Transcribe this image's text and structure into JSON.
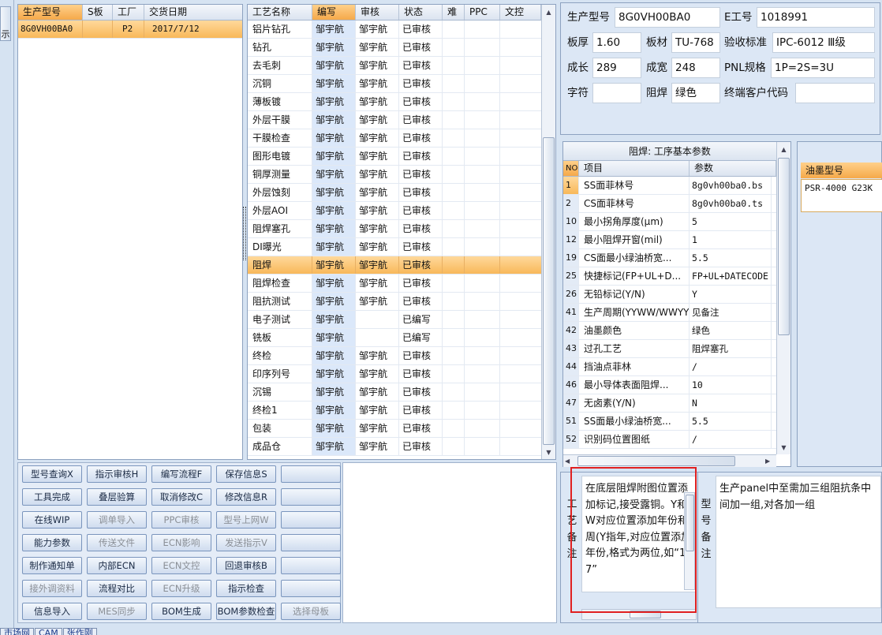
{
  "orders": {
    "headers": [
      "生产型号",
      "S板",
      "工厂",
      "交货日期"
    ],
    "rows": [
      [
        "8G0VH00BA0",
        "",
        "P2",
        "2017/7/12"
      ]
    ]
  },
  "left_stub": {
    "text": "示"
  },
  "process": {
    "headers": [
      "工艺名称",
      "编写",
      "审核",
      "状态",
      "难",
      "PPC",
      "文控"
    ],
    "rows": [
      [
        "铝片钻孔",
        "邹宇航",
        "邹宇航",
        "已审核"
      ],
      [
        "钻孔",
        "邹宇航",
        "邹宇航",
        "已审核"
      ],
      [
        "去毛刺",
        "邹宇航",
        "邹宇航",
        "已审核"
      ],
      [
        "沉铜",
        "邹宇航",
        "邹宇航",
        "已审核"
      ],
      [
        "薄板镀",
        "邹宇航",
        "邹宇航",
        "已审核"
      ],
      [
        "外层干膜",
        "邹宇航",
        "邹宇航",
        "已审核"
      ],
      [
        "干膜检查",
        "邹宇航",
        "邹宇航",
        "已审核"
      ],
      [
        "图形电镀",
        "邹宇航",
        "邹宇航",
        "已审核"
      ],
      [
        "铜厚测量",
        "邹宇航",
        "邹宇航",
        "已审核"
      ],
      [
        "外层蚀刻",
        "邹宇航",
        "邹宇航",
        "已审核"
      ],
      [
        "外层AOI",
        "邹宇航",
        "邹宇航",
        "已审核"
      ],
      [
        "阻焊塞孔",
        "邹宇航",
        "邹宇航",
        "已审核"
      ],
      [
        "DI曝光",
        "邹宇航",
        "邹宇航",
        "已审核"
      ],
      [
        "阻焊",
        "邹宇航",
        "邹宇航",
        "已审核"
      ],
      [
        "阻焊检查",
        "邹宇航",
        "邹宇航",
        "已审核"
      ],
      [
        "阻抗测试",
        "邹宇航",
        "邹宇航",
        "已审核"
      ],
      [
        "电子测试",
        "邹宇航",
        "",
        "已编写"
      ],
      [
        "铣板",
        "邹宇航",
        "",
        "已编写"
      ],
      [
        "终检",
        "邹宇航",
        "邹宇航",
        "已审核"
      ],
      [
        "印序列号",
        "邹宇航",
        "邹宇航",
        "已审核"
      ],
      [
        "沉锡",
        "邹宇航",
        "邹宇航",
        "已审核"
      ],
      [
        "终检1",
        "邹宇航",
        "邹宇航",
        "已审核"
      ],
      [
        "包装",
        "邹宇航",
        "邹宇航",
        "已审核"
      ],
      [
        "成品仓",
        "邹宇航",
        "邹宇航",
        "已审核"
      ]
    ],
    "selected_index": 13
  },
  "buttons": [
    {
      "label": "型号查询X",
      "enabled": true
    },
    {
      "label": "指示审核H",
      "enabled": true
    },
    {
      "label": "编写流程F",
      "enabled": true
    },
    {
      "label": "保存信息S",
      "enabled": true
    },
    {
      "label": "",
      "enabled": true
    },
    {
      "label": "工具完成",
      "enabled": true
    },
    {
      "label": "叠层验算",
      "enabled": true
    },
    {
      "label": "取消修改C",
      "enabled": true
    },
    {
      "label": "修改信息R",
      "enabled": true
    },
    {
      "label": "",
      "enabled": true
    },
    {
      "label": "在线WIP",
      "enabled": true
    },
    {
      "label": "调单导入",
      "enabled": false
    },
    {
      "label": "PPC审核",
      "enabled": false
    },
    {
      "label": "型号上网W",
      "enabled": false
    },
    {
      "label": "",
      "enabled": true
    },
    {
      "label": "能力参数",
      "enabled": true
    },
    {
      "label": "传送文件",
      "enabled": false
    },
    {
      "label": "ECN影响",
      "enabled": false
    },
    {
      "label": "发送指示V",
      "enabled": false
    },
    {
      "label": "",
      "enabled": true
    },
    {
      "label": "制作通知单",
      "enabled": true
    },
    {
      "label": "内部ECN",
      "enabled": true
    },
    {
      "label": "ECN文控",
      "enabled": false
    },
    {
      "label": "回退审核B",
      "enabled": true
    },
    {
      "label": "",
      "enabled": true
    },
    {
      "label": "接外调资料",
      "enabled": false
    },
    {
      "label": "流程对比",
      "enabled": true
    },
    {
      "label": "ECN升级",
      "enabled": false
    },
    {
      "label": "指示检查",
      "enabled": true
    },
    {
      "label": "",
      "enabled": true
    },
    {
      "label": "信息导入",
      "enabled": true
    },
    {
      "label": "MES同步",
      "enabled": false
    },
    {
      "label": "BOM生成",
      "enabled": true
    },
    {
      "label": "BOM参数检查",
      "enabled": true
    },
    {
      "label": "选择母板",
      "enabled": false
    }
  ],
  "info": {
    "model_label": "生产型号",
    "model_value": "8G0VH00BA0",
    "eno_label": "E工号",
    "eno_value": "1018991",
    "thick_label": "板厚",
    "thick_value": "1.60",
    "material_label": "板材",
    "material_value": "TU-768",
    "std_label": "验收标准",
    "std_value": "IPC-6012 Ⅲ级",
    "len_label": "成长",
    "len_value": "289",
    "width_label": "成宽",
    "width_value": "248",
    "pnl_label": "PNL规格",
    "pnl_value": "1P=2S=3U",
    "char_label": "字符",
    "char_value": "",
    "mask_label": "阻焊",
    "mask_value": "绿色",
    "cust_label": "终端客户代码",
    "cust_value": ""
  },
  "params": {
    "title": "阻焊: 工序基本参数",
    "headers": [
      "NO",
      "项目",
      "参数"
    ],
    "rows": [
      [
        "1",
        "SS面菲林号",
        "8g0vh00ba0.bs"
      ],
      [
        "2",
        "CS面菲林号",
        "8g0vh00ba0.ts"
      ],
      [
        "10",
        "最小拐角厚度(μm)",
        "5"
      ],
      [
        "12",
        "最小阻焊开窗(mil)",
        "1"
      ],
      [
        "19",
        "CS面最小绿油桥宽...",
        "5.5"
      ],
      [
        "25",
        "快捷标记(FP+UL+D...",
        "FP+UL+DATECODE"
      ],
      [
        "26",
        "无铅标记(Y/N)",
        "Y"
      ],
      [
        "41",
        "生产周期(YYWW/WWYY)",
        "见备注"
      ],
      [
        "42",
        "油墨颜色",
        "绿色"
      ],
      [
        "43",
        "过孔工艺",
        "阻焊塞孔"
      ],
      [
        "44",
        "挡油点菲林",
        "/"
      ],
      [
        "46",
        "最小导体表面阻焊...",
        "10"
      ],
      [
        "47",
        "无卤素(Y/N)",
        "N"
      ],
      [
        "51",
        "SS面最小绿油桥宽...",
        "5.5"
      ],
      [
        "52",
        "识别码位置图纸",
        "/"
      ]
    ],
    "selected_index": 0
  },
  "ink": {
    "header": "油墨型号",
    "value": "PSR-4000 G23K"
  },
  "process_note": {
    "label": "工艺备注",
    "text": "在底层阻焊附图位置添加标记,接受露铜。Y和W对应位置添加年份和周(Y指年,对应位置添加年份,格式为两位,如“17”"
  },
  "model_note": {
    "label": "型号备注",
    "text": "生产panel中至需加三组阻抗条中间加一组,对各加一组"
  },
  "tabs": [
    "市场网",
    "CAM",
    "张作刚"
  ],
  "colors": {
    "selection": "#f8b859",
    "highlight_box": "#e02020"
  }
}
